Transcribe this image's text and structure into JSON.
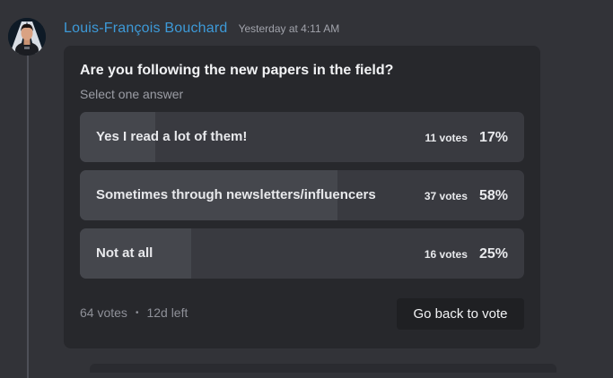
{
  "message": {
    "author": "Louis-François Bouchard",
    "timestamp": "Yesterday at 4:11 AM",
    "author_color": "#3d9ad8"
  },
  "poll": {
    "question": "Are you following the new papers in the field?",
    "hint": "Select one answer",
    "options": [
      {
        "label": "Yes I read a lot of them!",
        "votes": "11 votes",
        "percent": "17%",
        "fraction": 0.17
      },
      {
        "label": "Sometimes through newsletters/influencers",
        "votes": "37 votes",
        "percent": "58%",
        "fraction": 0.58
      },
      {
        "label": "Not at all",
        "votes": "16 votes",
        "percent": "25%",
        "fraction": 0.25
      }
    ],
    "total_votes": "64 votes",
    "separator": "•",
    "time_left": "12d left",
    "back_button_label": "Go back to vote"
  },
  "colors": {
    "background": "#323338",
    "card": "#27282c",
    "option_bg": "#393a40",
    "option_fill": "#45474d",
    "button_bg": "#1f2023"
  }
}
